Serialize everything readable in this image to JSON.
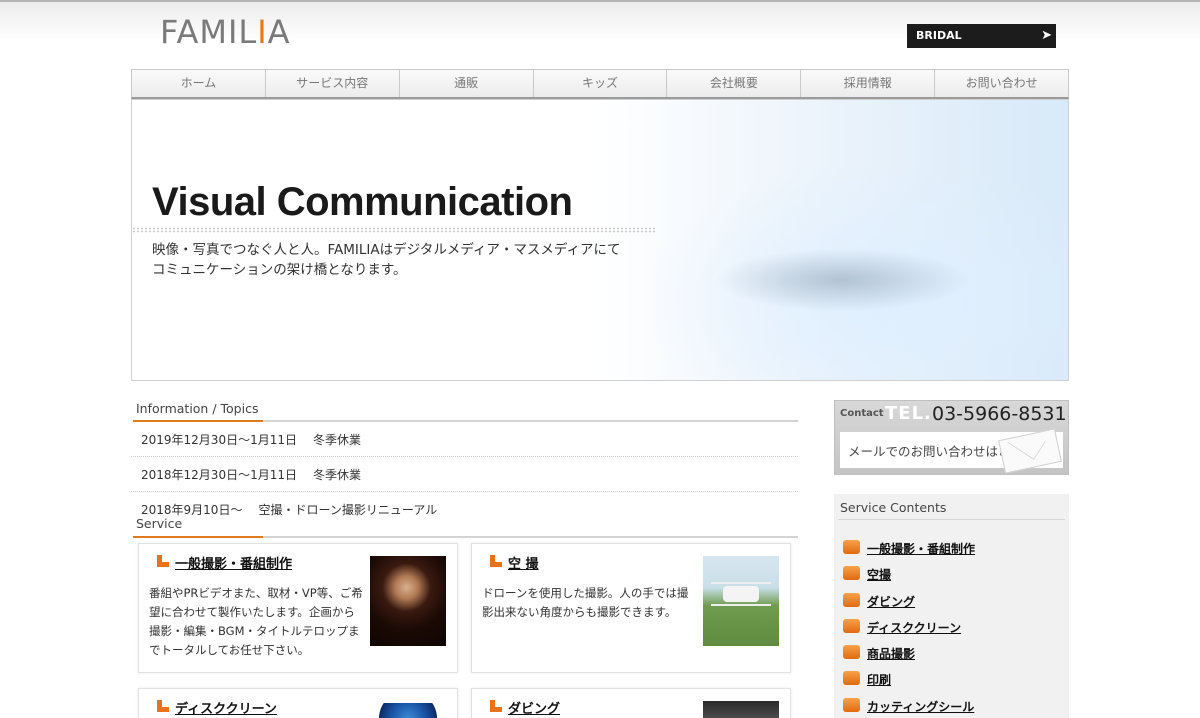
{
  "header": {
    "logo_main": "FAMIL",
    "logo_accent": "I",
    "logo_tail": "A",
    "bridal_label": "BRIDAL",
    "bridal_arrow": "➤"
  },
  "nav": {
    "items": [
      "ホーム",
      "サービス内容",
      "通販",
      "キッズ",
      "会社概要",
      "採用情報",
      "お問い合わせ"
    ]
  },
  "hero": {
    "title": "Visual Communication",
    "subtitle_line1": "映像・写真でつなぐ人と人。FAMILIAはデジタルメディア・マスメディアにて",
    "subtitle_line2": "コミュニケーションの架け橋となります。"
  },
  "topics": {
    "heading": "Information / Topics",
    "items": [
      {
        "date": "2019年12月30日〜1月11日",
        "text": "冬季休業"
      },
      {
        "date": "2018年12月30日〜1月11日",
        "text": "冬季休業"
      },
      {
        "date": "2018年9月10日〜",
        "text": "空撮・ドローン撮影リニューアル"
      }
    ]
  },
  "service": {
    "heading": "Service",
    "cards": [
      {
        "title": "一般撮影・番組制作",
        "text": "番組やPRビデオまた、取材・VP等、ご希望に合わせて製作いたします。企画から撮影・編集・BGM・タイトルテロップまでトータルしてお任せ下さい。",
        "image_icon": "woman-photo-icon"
      },
      {
        "title": "空 撮",
        "text": "ドローンを使用した撮影。人の手では撮影出来ない角度からも撮影できます。",
        "image_icon": "drone-photo-icon"
      },
      {
        "title": "ディスククリーン",
        "text": "",
        "image_icon": "disc-photo-icon"
      },
      {
        "title": "ダビング",
        "text": "",
        "image_icon": "dubbing-photo-icon"
      }
    ]
  },
  "contact": {
    "label": "Contact",
    "tel_label": "TEL.",
    "tel_number": "03-5966-8531",
    "mail_label": "メールでのお問い合わせはこちら"
  },
  "sidebar": {
    "heading": "Service Contents",
    "items": [
      "一般撮影・番組制作",
      "空撮",
      "ダビング",
      "ディスククリーン",
      "商品撮影",
      "印刷",
      "カッティングシール"
    ]
  },
  "colors": {
    "accent": "#e07a1f",
    "dark": "#1c1c1c"
  }
}
